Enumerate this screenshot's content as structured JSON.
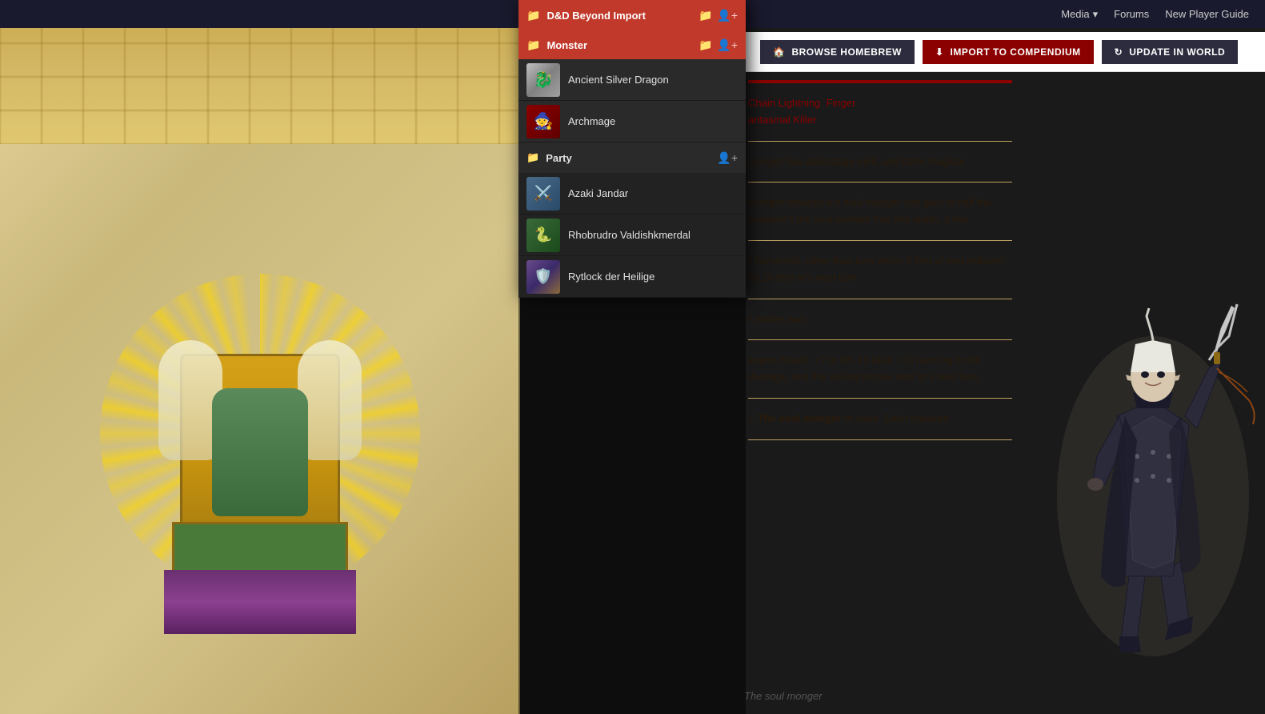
{
  "topNav": {
    "items": [
      {
        "label": "Media",
        "hasDropdown": true
      },
      {
        "label": "Forums",
        "hasDropdown": false
      },
      {
        "label": "New Player Guide",
        "hasDropdown": false
      }
    ]
  },
  "actionButtons": {
    "browse": "Browse Homebrew",
    "import": "Import to Compendium",
    "update": "Update in World"
  },
  "dropdown": {
    "header": {
      "title": "D&D Beyond Import",
      "folderIcon": "📁"
    },
    "monsterSection": {
      "title": "Monster",
      "items": [
        {
          "name": "Ancient Silver Dragon",
          "thumbType": "dragon"
        },
        {
          "name": "Archmage",
          "thumbType": "archmage"
        }
      ]
    },
    "partySection": {
      "title": "Party",
      "members": [
        {
          "name": "Azaki Jandar",
          "avatarType": "azaki"
        },
        {
          "name": "Rhobrudro Valdishkmerdal",
          "avatarType": "rhobrudro"
        },
        {
          "name": "Rytlock der Heilige",
          "avatarType": "rytlock"
        }
      ]
    }
  },
  "content": {
    "spellLinks": [
      "Chain Lightning",
      "Finger",
      "antasmal Killer"
    ],
    "paragraphs": [
      "monger has advantage pells and other magical",
      "monger reduces a e soul monger can gain to half the creature's the soul monger has this ability, it has",
      "r humanoid, other than turn within 5 feet of eed reduced by 20 feet re's next turn.",
      "r makes two",
      "eapon Attack: +7 to hit, 13 (4d4 + 3) piercing crotic damage, and the saving throws until er's next turn.",
      "). The soul monger ot cube. Each creature"
    ],
    "bottomCaption": "The soul monger"
  }
}
